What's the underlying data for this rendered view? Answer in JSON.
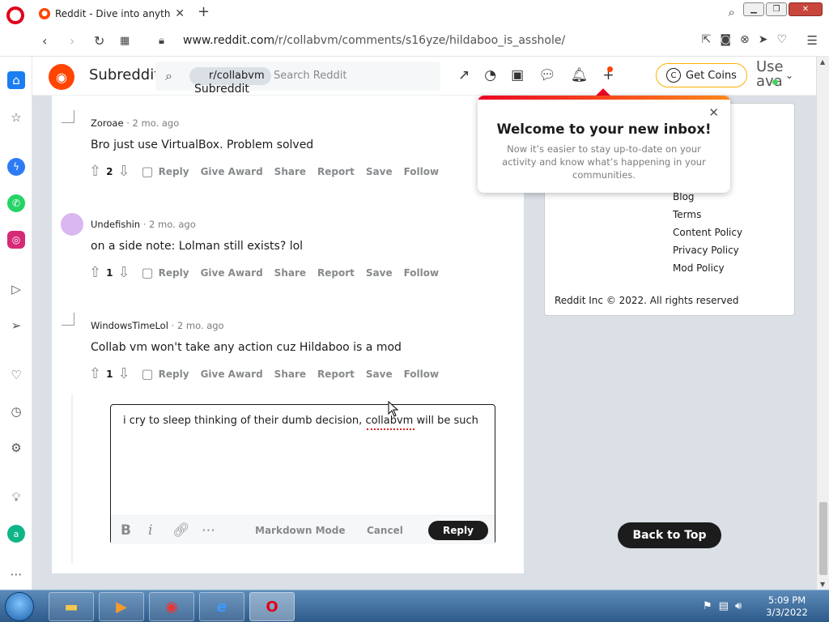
{
  "browser": {
    "tab_title": "Reddit - Dive into anything",
    "url_host": "www.reddit.com",
    "url_path": "/r/collabvm/comments/s16yze/hildaboo_is_asshole/"
  },
  "header": {
    "logo_alt": "Subreddit",
    "chip_label": "r/collabvm",
    "chip_alt": "Subreddit Icon",
    "search_placeholder": "Search Reddit",
    "get_coins": "Get Coins",
    "user_alt_1": "Use",
    "user_alt_2": "ava"
  },
  "comments": [
    {
      "author": "Zoroae",
      "time": " · 2 mo. ago",
      "body": "Bro just use VirtualBox. Problem solved",
      "votes": "2"
    },
    {
      "author": "Undefishin",
      "time": " · 2 mo. ago",
      "body": "on a side note: Lolman still exists? lol",
      "votes": "1"
    },
    {
      "author": "WindowsTimeLol",
      "time": " · 2 mo. ago",
      "body": "Collab vm won't take any action cuz Hildaboo is a mod",
      "votes": "1"
    }
  ],
  "actions": {
    "reply": "Reply",
    "give_award": "Give Award",
    "share": "Share",
    "report": "Report",
    "save": "Save",
    "follow": "Follow"
  },
  "editor": {
    "text": "i cry to sleep thinking of their dumb decision, collabvm will be such",
    "markdown_mode": "Markdown Mode",
    "cancel": "Cancel",
    "reply": "Reply"
  },
  "popup": {
    "title": "Welcome to your new inbox!",
    "subtitle": "Now it’s easier to stay up-to-date on your activity and know what’s happening in your communities."
  },
  "sidebar_links": [
    "Blog",
    "Terms",
    "Content Policy",
    "Privacy Policy",
    "Mod Policy"
  ],
  "copyright": "Reddit Inc © 2022. All rights reserved",
  "back_to_top": "Back to Top",
  "taskbar": {
    "time": "5:09 PM",
    "date": "3/3/2022"
  }
}
